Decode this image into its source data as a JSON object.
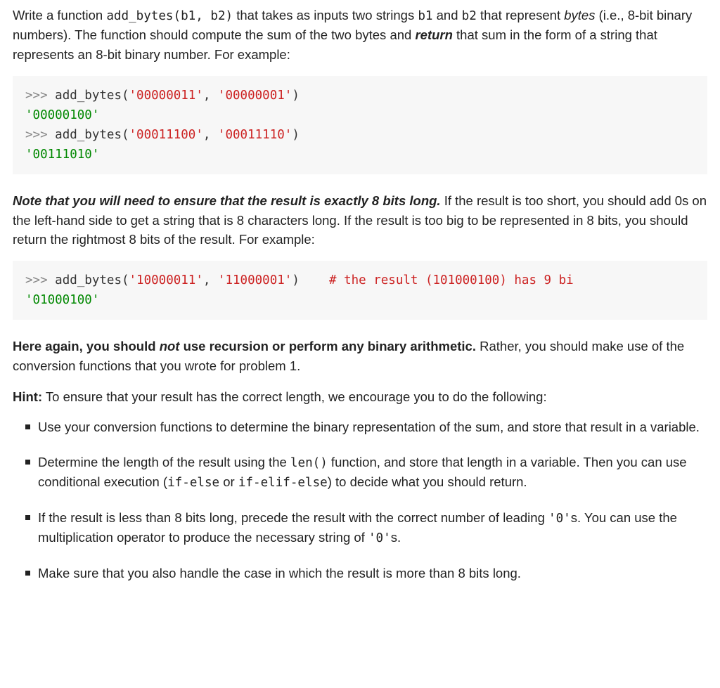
{
  "p1": {
    "t1": "Write a function ",
    "code1": "add_bytes(b1, b2)",
    "t2": " that takes as inputs two strings ",
    "code2": "b1",
    "t3": " and ",
    "code3": "b2",
    "t4": " that represent ",
    "em1": "bytes",
    "t5": " (i.e., 8-bit binary numbers). The function should compute the sum of the two bytes and ",
    "em2": "return",
    "t6": " that sum in the form of a string that represents an 8-bit binary number. For example:"
  },
  "code1": {
    "l1_prompt": ">>> ",
    "l1_call_a": "add_bytes(",
    "l1_s1": "'00000011'",
    "l1_call_b": ", ",
    "l1_s2": "'00000001'",
    "l1_call_c": ")",
    "l2_out": "'00000100'",
    "l3_prompt": ">>> ",
    "l3_call_a": "add_bytes(",
    "l3_s1": "'00011100'",
    "l3_call_b": ", ",
    "l3_s2": "'00011110'",
    "l3_call_c": ")",
    "l4_out": "'00111010'"
  },
  "p2": {
    "em1": "Note that you will need to ensure that the result is exactly 8 bits long.",
    "t1": " If the result is too short, you should add 0s on the left-hand side to get a string that is 8 characters long. If the result is too big to be represented in 8 bits, you should return the rightmost 8 bits of the result. For example:"
  },
  "code2": {
    "l1_prompt": ">>> ",
    "l1_call_a": "add_bytes(",
    "l1_s1": "'10000011'",
    "l1_call_b": ", ",
    "l1_s2": "'11000001'",
    "l1_call_c": ")    ",
    "l1_comment": "# the result (101000100) has 9 bi",
    "l2_out": "'01000100'"
  },
  "p3": {
    "b1": "Here again, you should ",
    "em1": "not",
    "b2": " use recursion or perform any binary arithmetic.",
    "t1": " Rather, you should make use of the conversion functions that you wrote for problem 1."
  },
  "p4": {
    "b1": "Hint:",
    "t1": " To ensure that your result has the correct length, we encourage you to do the following:"
  },
  "li1": "Use your conversion functions to determine the binary representation of the sum, and store that result in a variable.",
  "li2": {
    "t1": "Determine the length of the result using the ",
    "c1": "len()",
    "t2": " function, and store that length in a variable. Then you can use conditional execution (",
    "c2": "if-else",
    "t3": " or ",
    "c3": "if-elif-else",
    "t4": ") to decide what you should return."
  },
  "li3": {
    "t1": "If the result is less than 8 bits long, precede the result with the correct number of leading ",
    "c1": "'0'",
    "t2": "s. You can use the multiplication operator to produce the necessary string of ",
    "c2": "'0'",
    "t3": "s."
  },
  "li4": "Make sure that you also handle the case in which the result is more than 8 bits long."
}
